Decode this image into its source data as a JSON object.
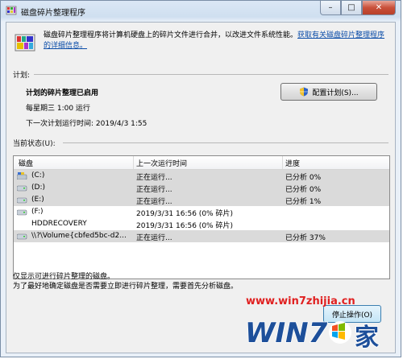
{
  "window": {
    "title": "磁盘碎片整理程序",
    "min": "–",
    "max": "□",
    "close": "✕"
  },
  "intro": {
    "text": "磁盘碎片整理程序将计算机硬盘上的碎片文件进行合并，以改进文件系统性能。",
    "link": "获取有关磁盘碎片整理程序的详细信息。"
  },
  "schedule": {
    "label": "计划:",
    "title": "计划的碎片整理已启用",
    "frequency": "每星期三  1:00 运行",
    "next_run": "下一次计划运行时间: 2019/4/3 1:55",
    "config_button": "配置计划(S)..."
  },
  "status": {
    "label": "当前状态(U):",
    "columns": [
      "磁盘",
      "上一次运行时间",
      "进度"
    ],
    "rows": [
      {
        "disk": "(C:)",
        "last_run": "正在运行...",
        "progress": "已分析 0%"
      },
      {
        "disk": "(D:)",
        "last_run": "正在运行...",
        "progress": "已分析 0%"
      },
      {
        "disk": "(E:)",
        "last_run": "正在运行...",
        "progress": "已分析 1%"
      },
      {
        "disk": "(F:)",
        "last_run": "2019/3/31 16:56 (0% 碎片)",
        "progress": ""
      },
      {
        "disk": "HDDRECOVERY",
        "last_run": "2019/3/31 16:56 (0% 碎片)",
        "progress": ""
      },
      {
        "disk": "\\\\?\\Volume{cbfed5bc-d2...",
        "last_run": "正在运行...",
        "progress": "已分析 37%"
      }
    ]
  },
  "footer": {
    "line1": "仅显示可进行碎片整理的磁盘。",
    "line2": "为了最好地确定磁盘是否需要立即进行碎片整理，需要首先分析磁盘。"
  },
  "close_button": "停止操作(O)",
  "watermark": {
    "url": "www.win7zhijia.cn",
    "brand": "WIN7",
    "suffix": "家"
  },
  "colors": {
    "link": "#0a4ca8",
    "selected_row": "#dadada",
    "watermark_red": "#e02020"
  }
}
